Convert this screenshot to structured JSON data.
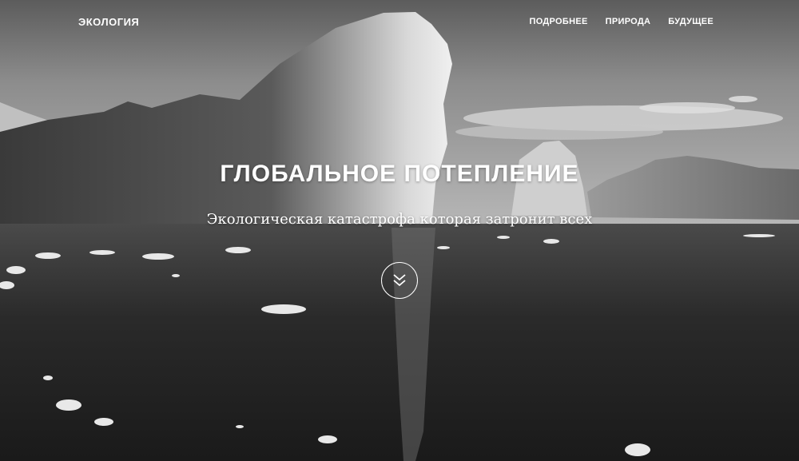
{
  "nav": {
    "brand": "ЭКОЛОГИЯ",
    "links": [
      {
        "label": "ПОДРОБНЕЕ"
      },
      {
        "label": "ПРИРОДА"
      },
      {
        "label": "БУДУЩЕЕ"
      }
    ]
  },
  "hero": {
    "title": "ГЛОБАЛЬНОЕ ПОТЕПЛЕНИЕ",
    "subtitle": "Экологическая катастрофа которая затронит всех",
    "scroll_icon": "double-chevron-down-icon"
  },
  "colors": {
    "text": "#ffffff",
    "sky": "#8a8a8a",
    "water": "#1e1e1e"
  }
}
